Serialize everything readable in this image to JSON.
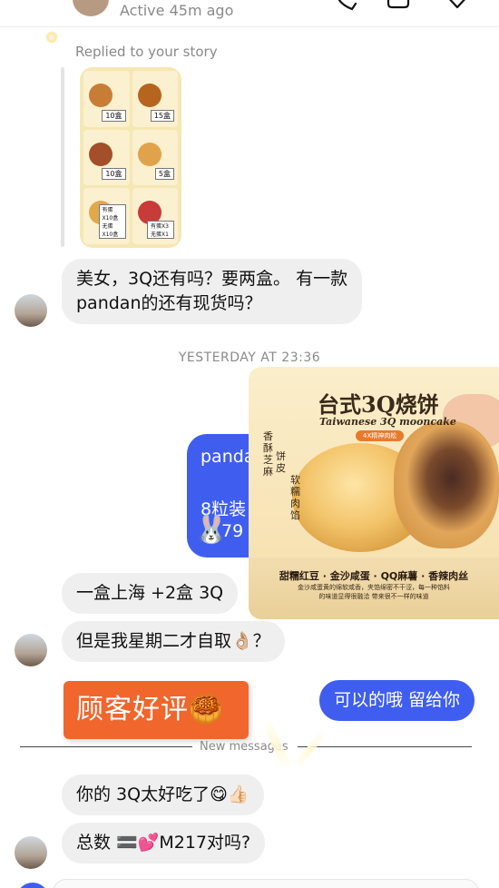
{
  "header": {
    "status": "Active 45m ago"
  },
  "story_reply": {
    "label": "Replied to your story",
    "thumbnail_tags": [
      "10盒",
      "15盒",
      "10盒",
      "5盒",
      "有蛋 X10盒 无蛋 X10盒",
      "有蛋X3 无蛋X1"
    ]
  },
  "messages": {
    "m1_line1": "美女，3Q还有吗？要两盒。 有一款",
    "m1_line2": "pandan的还有现货吗？",
    "timestamp": "YESTERDAY AT 23:36",
    "blue_line1": "panda",
    "blue_line2": "8粒装",
    "blue_line3": "79",
    "m2": "一盒上海 +2盒 3Q",
    "m3": "但是我星期二才自取👌🏼？",
    "sticker": "顾客好评🥮",
    "reply_out": "可以的哦 留给你",
    "new_messages": "New messages",
    "m4": "你的 3Q太好吃了😋👍🏻",
    "m5": "总数 🟰💕M217对吗?"
  },
  "mooncake_card": {
    "title": "台式3Q烧饼",
    "subtitle": "Taiwanese 3Q mooncake",
    "pill": "4X精神肉松",
    "side_text_1": "香酥芝麻",
    "side_text_2": "饼皮",
    "side_text_3": "软糯肉馅",
    "flavors": "甜糯红豆 · 金沙咸蛋 · QQ麻薯 · 香辣肉丝",
    "desc_line1": "金沙咸蛋黄的绵软咸香，夹馅绵密不干涩，每一种馅料",
    "desc_line2": "的味道显得很融洽 带来很不一样的味道"
  },
  "colors": {
    "accent_blue": "#3f5ef0",
    "incoming_gray": "#efefef",
    "sticker_orange": "#f0662d"
  }
}
